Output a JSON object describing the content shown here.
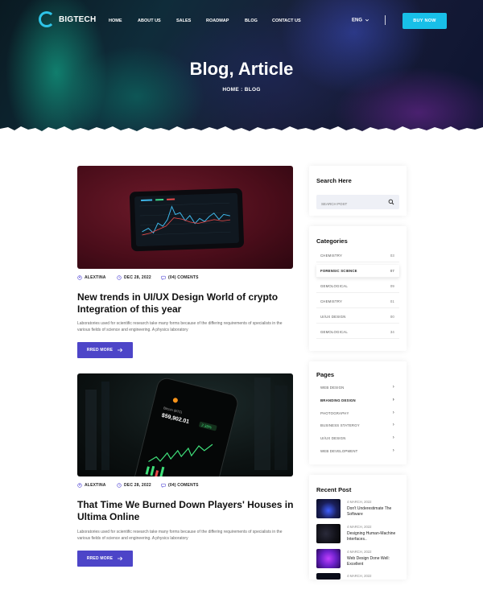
{
  "brand": {
    "name": "BIGTECH"
  },
  "nav": {
    "items": [
      "HOME",
      "ABOUT US",
      "SALES",
      "ROADMAP",
      "BLOG",
      "CONTACT US"
    ]
  },
  "header": {
    "lang": "ENG",
    "buy_label": "BUY NOW"
  },
  "hero": {
    "title": "Blog, Article",
    "crumb_home": "HOME",
    "crumb_sep": ":",
    "crumb_active": "BLOG"
  },
  "posts": [
    {
      "author": "ALEXTINA",
      "date": "DEC 28, 2022",
      "comments": "(04) COMENTS",
      "title": "New trends in UI/UX Design World of crypto Integration of this year",
      "excerpt": "Laboratories used for scientific research take many forms because of the differing requirements of specialists in the various fields of science and engineering. A physics laboratory",
      "read_label": "RRED MORE"
    },
    {
      "author": "ALEXTINA",
      "date": "DEC 28, 2022",
      "comments": "(04) COMENTS",
      "title": "That Time We Burned Down Players' Houses in Ultima Online",
      "excerpt": "Laboratories used for scientific research take many forms because of the differing requirements of specialists in the various fields of science and engineering. A physics laboratory",
      "read_label": "RRED MORE",
      "balance": "$59,902.01",
      "balance_label": "Bitcoin (BTC)",
      "change": "2.38%"
    }
  ],
  "sidebar": {
    "search": {
      "title": "Search Here",
      "placeholder": "SEARCH POST"
    },
    "categories": {
      "title": "Categories",
      "items": [
        {
          "label": "CHEMISTRY",
          "count": "03"
        },
        {
          "label": "FORENSIC SCIENCE",
          "count": "07"
        },
        {
          "label": "GEMOLOGICAL",
          "count": "09"
        },
        {
          "label": "CHEMISTRY",
          "count": "01"
        },
        {
          "label": "UI/UX DESIGN",
          "count": "00"
        },
        {
          "label": "GEMOLOGICAL",
          "count": "34"
        }
      ]
    },
    "pages": {
      "title": "Pages",
      "items": [
        "WEB DESIGN",
        "BRANDING DESIGN",
        "PHOTOGRAPHY",
        "BUSINESS STATERGY",
        "UI/UX DESIGN",
        "WEB DEVELOPMENT"
      ]
    },
    "recent": {
      "title": "Recent Post",
      "items": [
        {
          "date": "4 MARCH, 2022",
          "title": "Don't Underestimate The Software"
        },
        {
          "date": "4 MARCH, 2022",
          "title": "Designing Human-Machine Interfaces.."
        },
        {
          "date": "4 MARCH, 2022",
          "title": "Web Design Done Well: Excellent"
        },
        {
          "date": "4 MARCH, 2022",
          "title": ""
        }
      ]
    }
  },
  "colors": {
    "accent": "#4d45c8",
    "buy": "#18bfe8"
  }
}
